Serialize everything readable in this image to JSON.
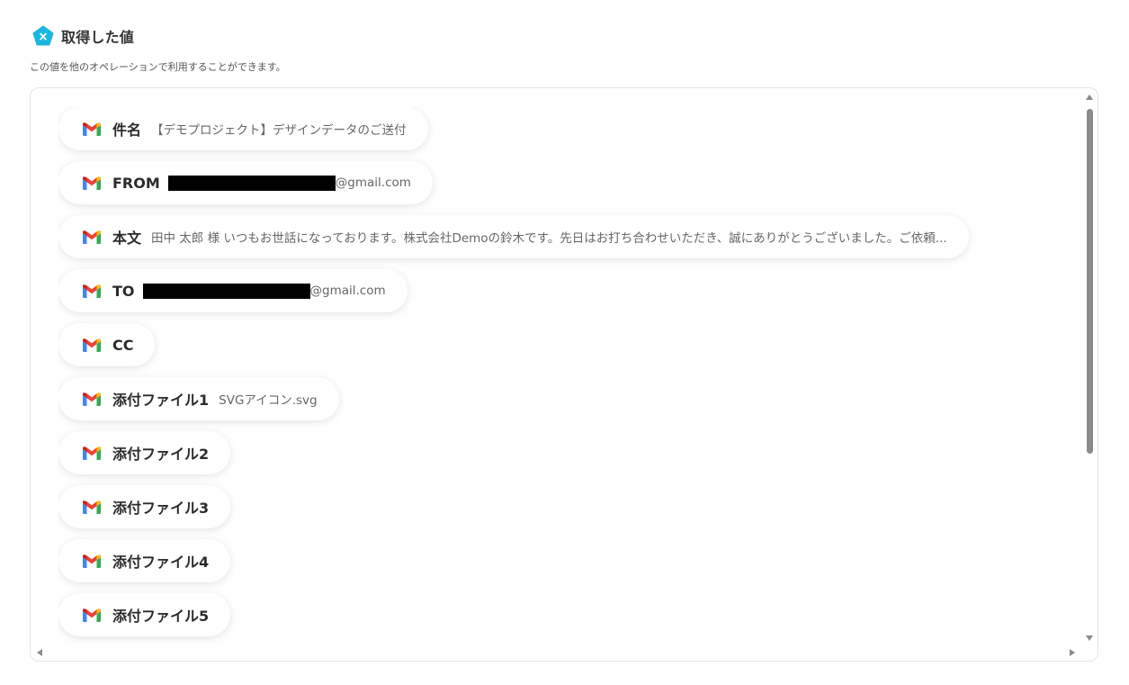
{
  "header": {
    "title": "取得した値",
    "description": "この値を他のオペレーションで利用することができます。",
    "icon": "yoom-pentagon-x-icon",
    "accent_color": "#1ab6e0"
  },
  "items": [
    {
      "label": "件名",
      "value": "【デモプロジェクト】デザインデータのご送付",
      "redacted": false,
      "icon": "gmail-icon"
    },
    {
      "label": "FROM",
      "value": "@gmail.com",
      "redacted": true,
      "icon": "gmail-icon"
    },
    {
      "label": "本文",
      "value": "田中 太郎 様 いつもお世話になっております。株式会社Demoの鈴木です。先日はお打ち合わせいただき、誠にありがとうございました。ご依頼...",
      "redacted": false,
      "icon": "gmail-icon"
    },
    {
      "label": "TO",
      "value": "@gmail.com",
      "redacted": true,
      "icon": "gmail-icon"
    },
    {
      "label": "CC",
      "value": "",
      "redacted": false,
      "icon": "gmail-icon"
    },
    {
      "label": "添付ファイル1",
      "value": "SVGアイコン.svg",
      "redacted": false,
      "icon": "gmail-icon"
    },
    {
      "label": "添付ファイル2",
      "value": "",
      "redacted": false,
      "icon": "gmail-icon"
    },
    {
      "label": "添付ファイル3",
      "value": "",
      "redacted": false,
      "icon": "gmail-icon"
    },
    {
      "label": "添付ファイル4",
      "value": "",
      "redacted": false,
      "icon": "gmail-icon"
    },
    {
      "label": "添付ファイル5",
      "value": "",
      "redacted": false,
      "icon": "gmail-icon"
    }
  ]
}
